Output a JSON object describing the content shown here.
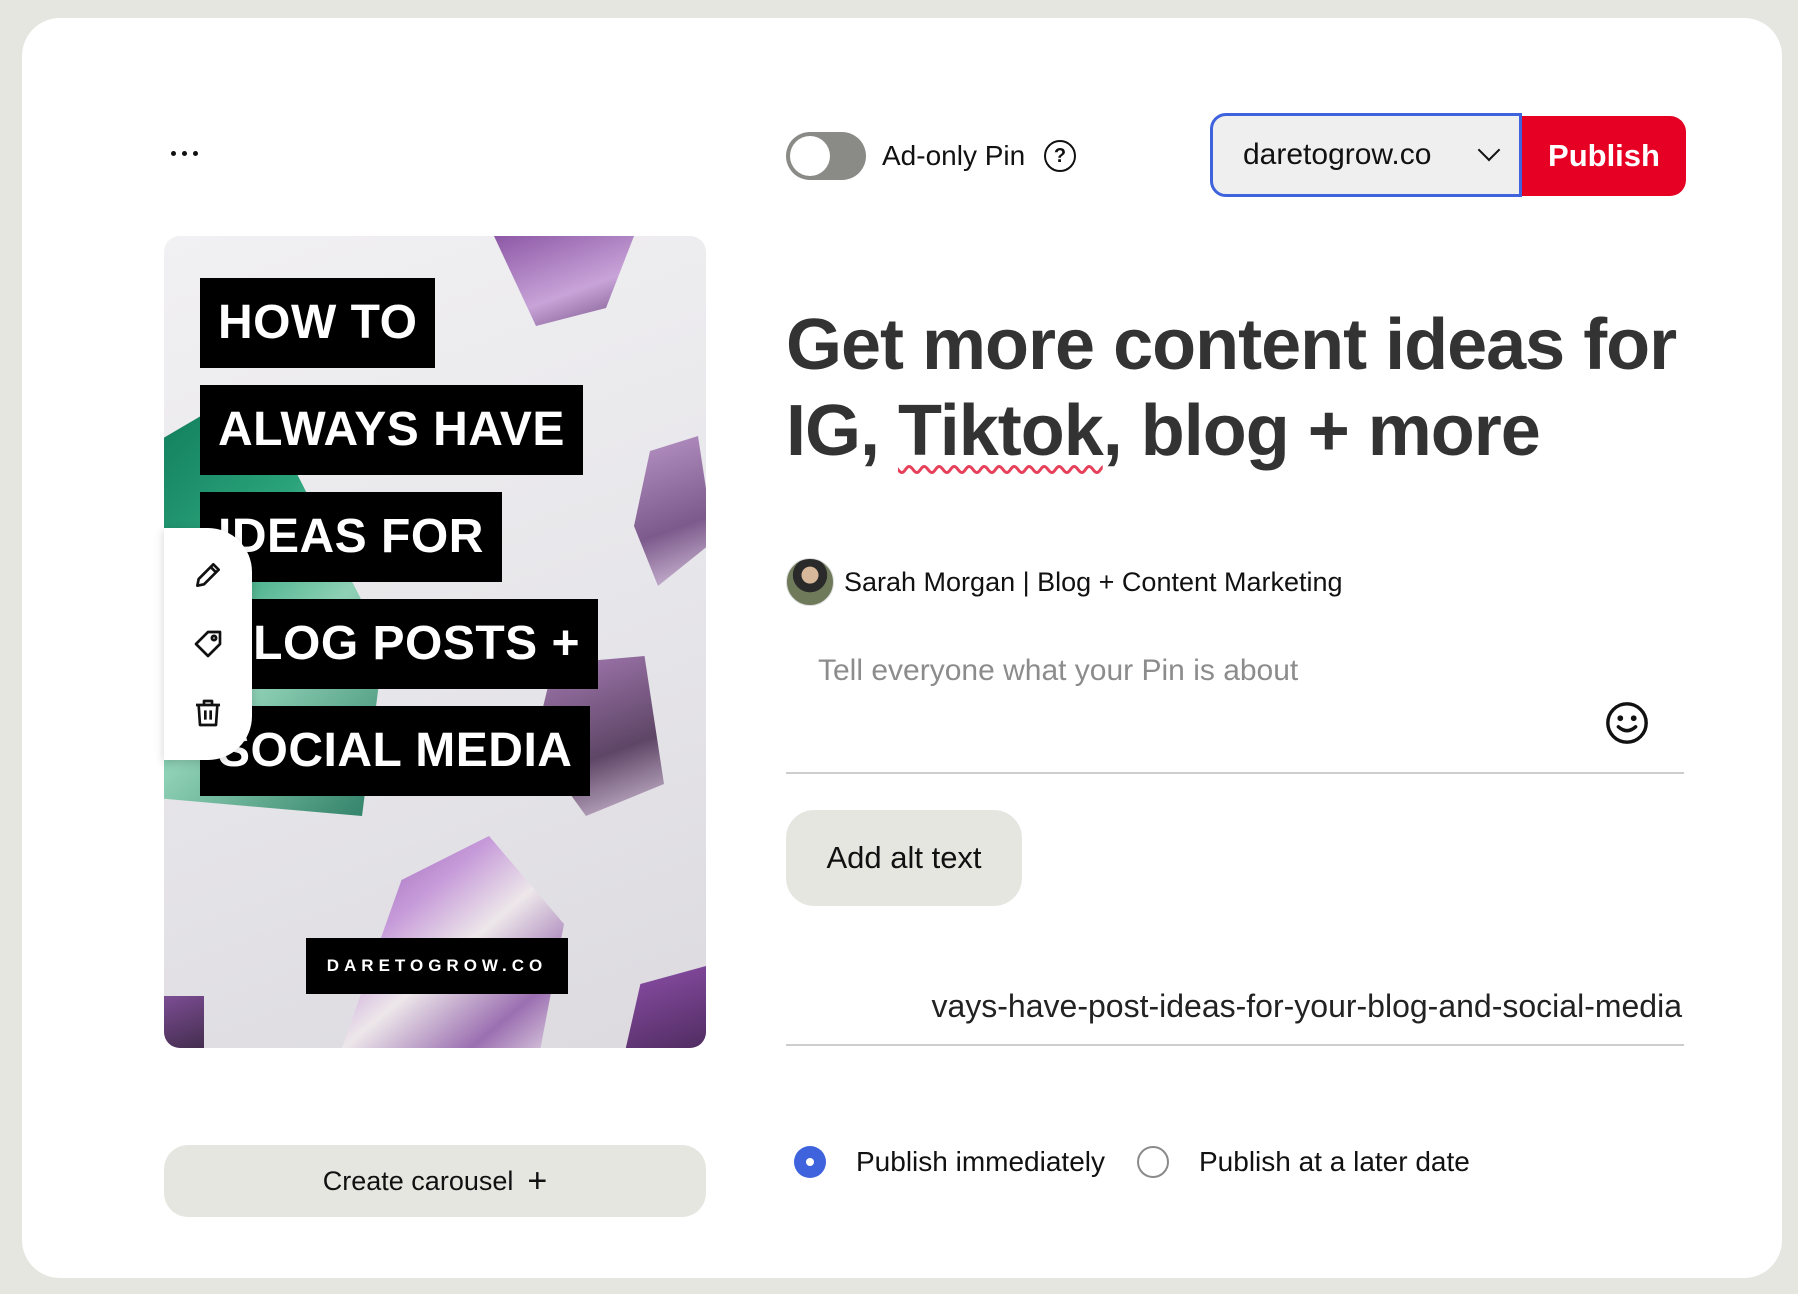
{
  "header": {
    "more_icon": "more-horizontal-icon",
    "ad_only_label": "Ad-only Pin",
    "ad_only_enabled": false,
    "help_symbol": "?",
    "account": "daretogrow.co",
    "publish_label": "Publish"
  },
  "colors": {
    "publish_red": "#e60023",
    "focus_blue": "#3e63dd",
    "button_gray": "#e6e6e1"
  },
  "pin_image": {
    "title_lines": [
      "HOW TO",
      "ALWAYS HAVE",
      "IDEAS FOR",
      "BLOG POSTS +",
      "SOCIAL MEDIA"
    ],
    "brand_badge": "DARETOGROW.CO",
    "tools": [
      "pencil-icon",
      "tag-icon",
      "trash-icon"
    ]
  },
  "carousel": {
    "label": "Create carousel",
    "icon_symbol": "+"
  },
  "pin_form": {
    "title_part1": "Get more content ideas for IG, ",
    "title_misspelled": "Tiktok",
    "title_part2": ", blog + more",
    "author": "Sarah Morgan | Blog + Content Marketing",
    "description_placeholder": "Tell everyone what your Pin is about",
    "emoji_icon": "smiley-icon",
    "alt_text_label": "Add alt text",
    "link_value": "vays-have-post-ideas-for-your-blog-and-social-media"
  },
  "schedule": {
    "options": [
      "Publish immediately",
      "Publish at a later date"
    ],
    "selected": "Publish immediately"
  }
}
